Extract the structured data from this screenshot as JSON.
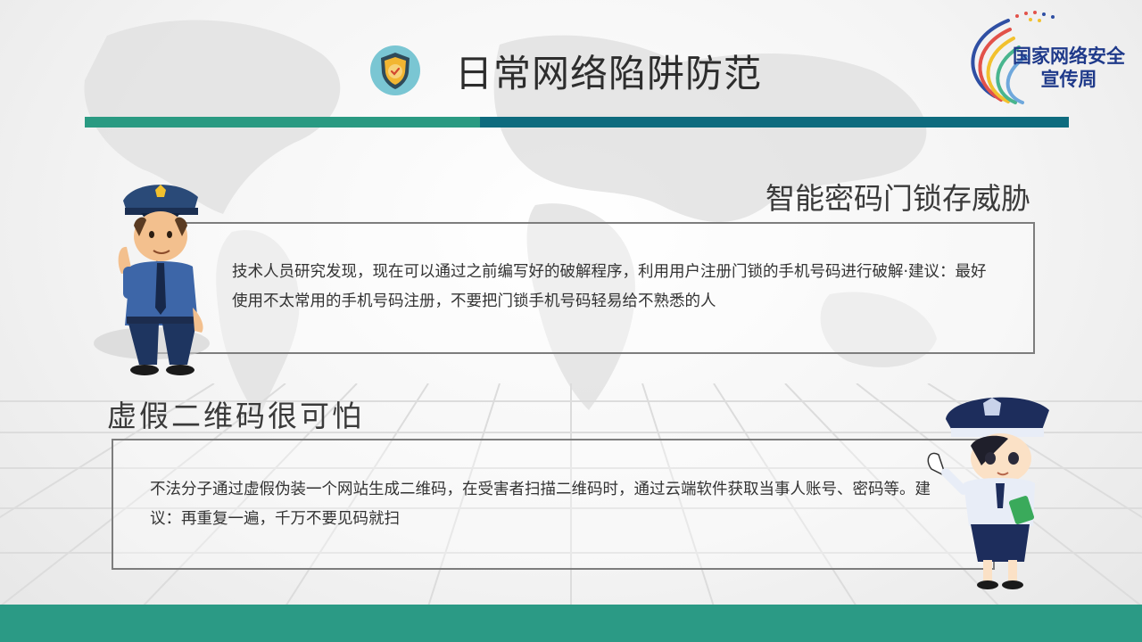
{
  "header": {
    "title": "日常网络陷阱防范",
    "logo_text_line1": "国家网络安全",
    "logo_text_line2": "宣传周"
  },
  "sections": [
    {
      "heading": "智能密码门锁存威胁",
      "body": "技术人员研究发现，现在可以通过之前编写好的破解程序，利用用户注册门锁的手机号码进行破解·建议：最好使用不太常用的手机号码注册，不要把门锁手机号码轻易给不熟悉的人"
    },
    {
      "heading": "虚假二维码很可怕",
      "body": "不法分子通过虚假伪装一个网站生成二维码，在受害者扫描二维码时，通过云端软件获取当事人账号、密码等。建议：再重复一遍，千万不要见码就扫"
    }
  ],
  "icons": [
    "shield-check-icon",
    "police-officer-illustration",
    "policewoman-illustration",
    "world-map-background"
  ],
  "colors": {
    "accent_green": "#2a9a82",
    "accent_teal": "#0e6b7e",
    "footer": "#2b9a85",
    "logo_blue": "#1f3a8a"
  }
}
